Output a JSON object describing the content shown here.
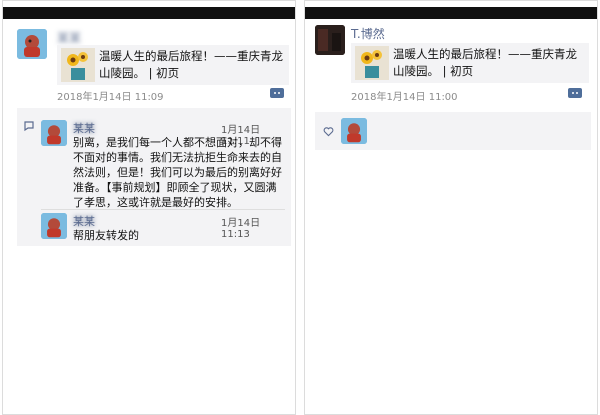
{
  "left": {
    "poster_name": "某某",
    "link_title": "温暖人生的最后旅程！——重庆青龙山陵园。 | 初页",
    "timestamp": "2018年1月14日 11:09",
    "comments": [
      {
        "name": "某某",
        "time": "1月14日 11:11",
        "text": "别离，是我们每一个人都不想面对，却不得不面对的事情。我们无法抗拒生命来去的自然法则，但是！我们可以为最后的别离好好准备。【事前规划】即顾全了现状，又圆满了孝思，这或许就是最好的安排。"
      },
      {
        "name": "某某",
        "time": "1月14日 11:13",
        "text": "帮朋友转发的"
      }
    ]
  },
  "right": {
    "poster_name": "T.博然",
    "link_title": "温暖人生的最后旅程！——重庆青龙山陵园。 | 初页",
    "timestamp": "2018年1月14日 11:00"
  },
  "colors": {
    "name_blue": "#5b6b90",
    "card_bg": "#f3f3f5",
    "more_button": "#4f6e9a"
  },
  "icons": {
    "comment": "comment-icon",
    "like": "heart-icon",
    "more": "more-dots-icon"
  }
}
